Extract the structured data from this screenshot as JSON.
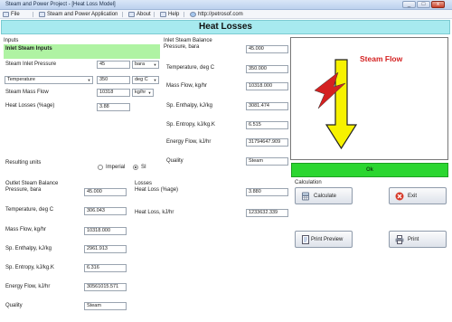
{
  "window": {
    "title": "Steam and Power Project - [Heat Loss Model]",
    "controls": [
      "_",
      "□",
      "x"
    ]
  },
  "menu": {
    "file": "File",
    "app": "Steam and Power Application",
    "about": "About",
    "help": "Help",
    "site": "http://petrosof.com"
  },
  "heading": "Heat Losses",
  "inputs": {
    "section": "Inputs",
    "banner": "Inlet Steam Inputs",
    "pressure_label": "Steam Inlet Pressure",
    "pressure_value": "45",
    "pressure_unit": "bara",
    "temp_selector": "Temperature",
    "temp_value": "350",
    "temp_unit": "deg C",
    "massflow_label": "Steam Mass Flow",
    "massflow_value": "10318",
    "massflow_unit": "kg/hr",
    "heatloss_label": "Heat Losses (%age)",
    "heatloss_value": "3.88"
  },
  "inlet_balance": {
    "section": "Inlet Steam Balance",
    "pressure_label": "Pressure, bara",
    "pressure": "45.000",
    "temp_label": "Temperature, deg C",
    "temp": "350.000",
    "mass_label": "Mass Flow, kg/hr",
    "mass": "10318.000",
    "enthalpy_label": "Sp. Enthalpy, kJ/kg",
    "enthalpy": "3081.474",
    "entropy_label": "Sp. Entropy, kJ/kg.K",
    "entropy": "6.515",
    "energy_label": "Energy Flow, kJ/hr",
    "energy": "31794647.909",
    "quality_label": "Quality",
    "quality": "Steam"
  },
  "units": {
    "label": "Resulting units",
    "imperial": "Imperial",
    "si": "SI",
    "selected": "SI"
  },
  "outlet_balance": {
    "section": "Outlet Steam Balance",
    "pressure_label": "Pressure, bara",
    "pressure": "45.000",
    "temp_label": "Temperature, deg C",
    "temp": "306.043",
    "mass_label": "Mass Flow, kg/hr",
    "mass": "10318.000",
    "enthalpy_label": "Sp. Enthalpy, kJ/kg",
    "enthalpy": "2961.913",
    "entropy_label": "Sp. Entropy, kJ/kg.K",
    "entropy": "6.316",
    "energy_label": "Energy Flow, kJ/hr",
    "energy": "30561015.571",
    "quality_label": "Quality",
    "quality": "Steam"
  },
  "losses": {
    "section": "Losses",
    "pct_label": "Heat Loss (%age)",
    "pct": "3.880",
    "kj_label": "Heat Loss, kJ/hr",
    "kj": "1233632.339"
  },
  "diagram": {
    "caption": "Steam Flow",
    "status": "Ok"
  },
  "calculation": {
    "section": "Calculation",
    "calculate": "Calculate",
    "exit": "Exit",
    "preview": "Print Preview",
    "print": "Print"
  },
  "colors": {
    "heading_bg": "#a7eaef",
    "banner_bg": "#aff3a3",
    "ok_bg": "#2bd630",
    "arrow": "#f7f200",
    "flow_text": "#d42121"
  }
}
